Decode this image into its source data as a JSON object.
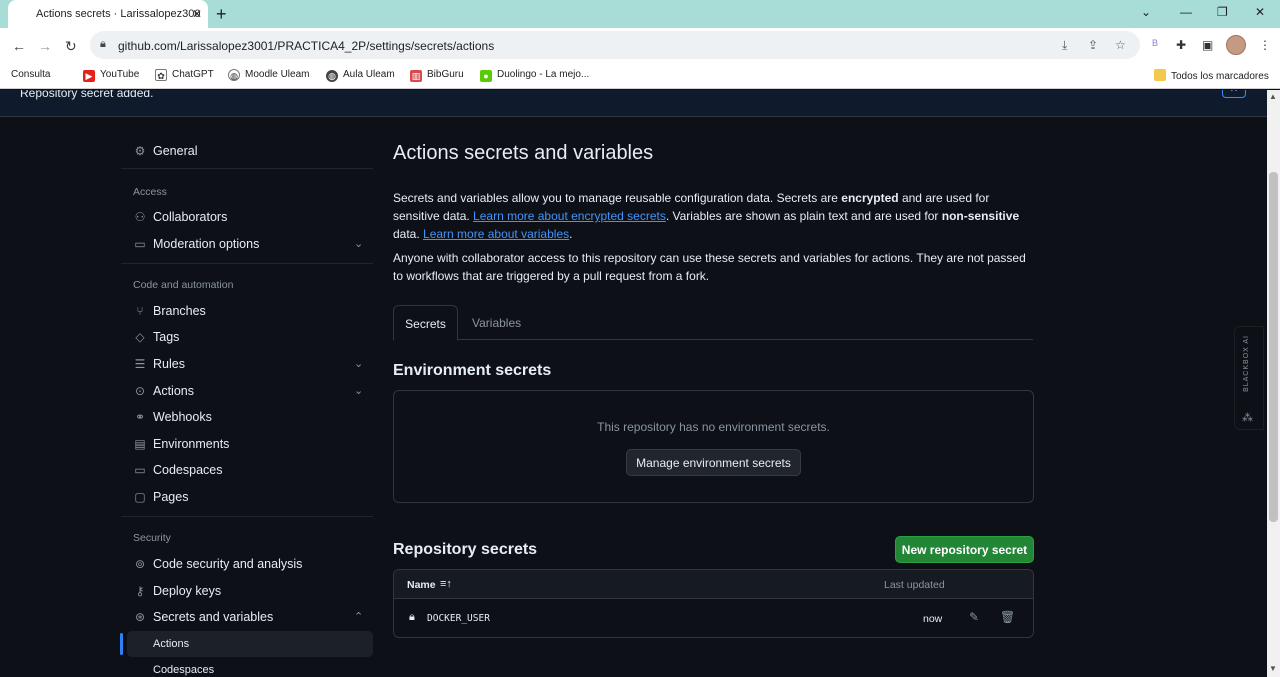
{
  "browser": {
    "tab_title": "Actions secrets · Larissalopez300",
    "url": "github.com/Larissalopez3001/PRACTICA4_2P/settings/secrets/actions",
    "new_tab": "+",
    "tab_close": "✕"
  },
  "bookmarks": [
    {
      "label": "Consulta"
    },
    {
      "label": "YouTube"
    },
    {
      "label": "ChatGPT"
    },
    {
      "label": "Moodle Uleam"
    },
    {
      "label": "Aula Uleam"
    },
    {
      "label": "BibGuru"
    },
    {
      "label": "Duolingo - La mejo..."
    },
    {
      "label": "Todos los marcadores"
    }
  ],
  "flash": {
    "message": "Repository secret added."
  },
  "sidebar": {
    "general": "General",
    "access_heading": "Access",
    "collaborators": "Collaborators",
    "moderation": "Moderation options",
    "code_heading": "Code and automation",
    "branches": "Branches",
    "tags": "Tags",
    "rules": "Rules",
    "actions": "Actions",
    "webhooks": "Webhooks",
    "environments": "Environments",
    "codespaces": "Codespaces",
    "pages": "Pages",
    "security_heading": "Security",
    "code_security": "Code security and analysis",
    "deploy_keys": "Deploy keys",
    "secrets_vars": "Secrets and variables",
    "sub_actions": "Actions",
    "sub_codespaces": "Codespaces"
  },
  "main": {
    "title": "Actions secrets and variables",
    "p1_a": "Secrets and variables allow you to manage reusable configuration data. Secrets are ",
    "p1_b": "encrypted",
    "p1_c": " and are used for sensitive data. ",
    "p1_link1": "Learn more about encrypted secrets",
    "p1_d": ". Variables are shown as plain text and are used for ",
    "p1_e": "non-sensitive",
    "p1_f": " data. ",
    "p1_link2": "Learn more about variables",
    "p1_g": ".",
    "p2": "Anyone with collaborator access to this repository can use these secrets and variables for actions. They are not passed to workflows that are triggered by a pull request from a fork.",
    "tab_secrets": "Secrets",
    "tab_variables": "Variables",
    "env_title": "Environment secrets",
    "env_empty": "This repository has no environment secrets.",
    "env_button": "Manage environment secrets",
    "repo_title": "Repository secrets",
    "new_secret_button": "New repository secret",
    "table": {
      "col_name": "Name",
      "col_updated": "Last updated",
      "rows": [
        {
          "name": "DOCKER_USER",
          "updated": "now"
        }
      ]
    }
  },
  "extension": {
    "label": "BLACKBOX AI"
  }
}
